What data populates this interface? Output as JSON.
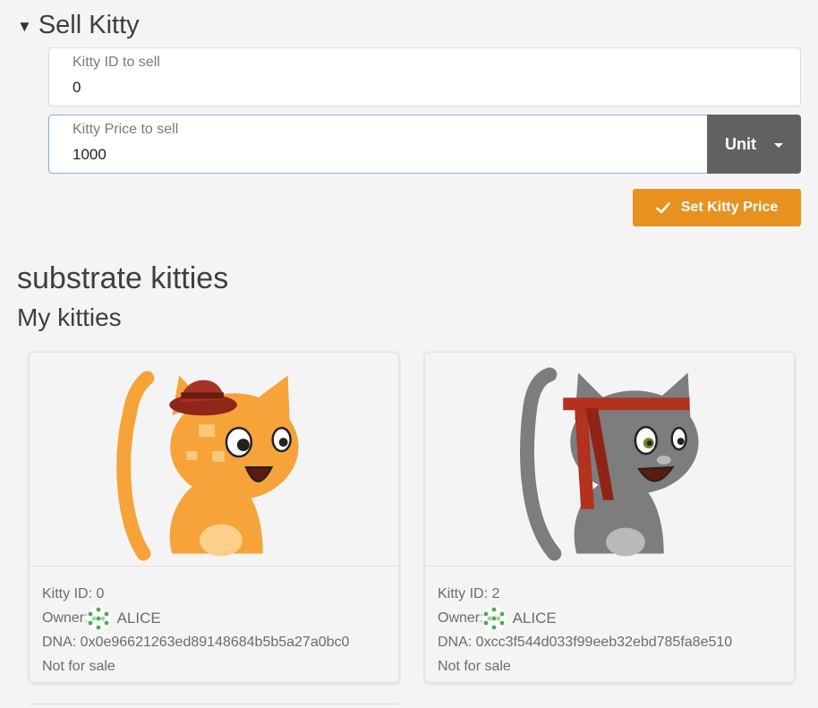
{
  "sell_section": {
    "title": "Sell Kitty",
    "kitty_id_label": "Kitty ID to sell",
    "kitty_id_value": "0",
    "price_label": "Kitty Price to sell",
    "price_value": "1000",
    "unit_label": "Unit",
    "submit_label": "Set Kitty Price"
  },
  "app_title": "substrate kitties",
  "my_kitties_title": "My kitties",
  "kitties": [
    {
      "id_text": "Kitty ID: 0",
      "owner_label": "Owner:",
      "owner_name": "ALICE",
      "dna_text": "DNA: 0x0e96621263ed89148684b5b5a27a0bc0",
      "status": "Not for sale",
      "colors": {
        "body": "#f6a33a",
        "accent": "#fcd08a",
        "hat": "#a83223"
      },
      "accessory": "red fedora hat"
    },
    {
      "id_text": "Kitty ID: 2",
      "owner_label": "Owner:",
      "owner_name": "ALICE",
      "dna_text": "DNA: 0xcc3f544d033f99eeb32ebd785fa8e510",
      "status": "Not for sale",
      "colors": {
        "body": "#7d7d7d",
        "accent": "#b9b9b9",
        "hat": "#b2311f"
      },
      "accessory": "red headband"
    }
  ]
}
